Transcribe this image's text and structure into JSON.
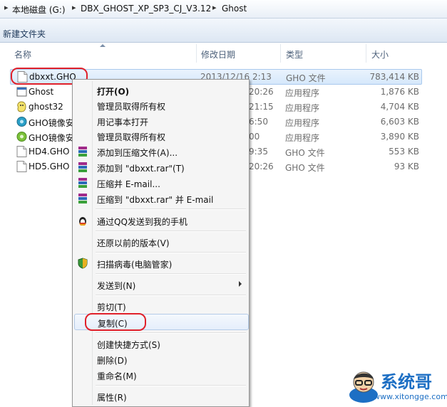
{
  "address": {
    "crumbs": [
      "本地磁盘 (G:)",
      "DBX_GHOST_XP_SP3_CJ_V3.12",
      "Ghost"
    ]
  },
  "toolbar": {
    "new_folder": "新建文件夹"
  },
  "columns": {
    "name": "名称",
    "date": "修改日期",
    "type": "类型",
    "size": "大小"
  },
  "files": [
    {
      "name": "dbxxt.GHO",
      "date": "2013/12/16 2:13",
      "type": "GHO 文件",
      "size": "783,414 KB",
      "icon": "document-icon"
    },
    {
      "name": "Ghost",
      "date": "20:26",
      "type": "应用程序",
      "size": "1,876 KB",
      "icon": "ghost-app-icon"
    },
    {
      "name": "ghost32",
      "date": "21:15",
      "type": "应用程序",
      "size": "4,704 KB",
      "icon": "ghost32-app-icon"
    },
    {
      "name": "GHO镜像安",
      "date": "6:50",
      "type": "应用程序",
      "size": "6,603 KB",
      "icon": "installer-icon"
    },
    {
      "name": "GHO镜像安",
      "date": "00",
      "type": "应用程序",
      "size": "3,890 KB",
      "icon": "installer-icon"
    },
    {
      "name": "HD4.GHO",
      "date": "9:35",
      "type": "GHO 文件",
      "size": "553 KB",
      "icon": "document-icon"
    },
    {
      "name": "HD5.GHO",
      "date": "20:26",
      "type": "GHO 文件",
      "size": "93 KB",
      "icon": "document-icon"
    }
  ],
  "menu": {
    "open": "打开(O)",
    "admin_owner_1": "管理员取得所有权",
    "open_notepad": "用记事本打开",
    "admin_owner_2": "管理员取得所有权",
    "add_archive": "添加到压缩文件(A)...",
    "add_rar": "添加到 \"dbxxt.rar\"(T)",
    "compress_email": "压缩并 E-mail...",
    "compress_rar_email": "压缩到 \"dbxxt.rar\" 并 E-mail",
    "qq_send": "通过QQ发送到我的手机",
    "restore": "还原以前的版本(V)",
    "scan": "扫描病毒(电脑管家)",
    "send_to": "发送到(N)",
    "cut": "剪切(T)",
    "copy": "复制(C)",
    "shortcut": "创建快捷方式(S)",
    "delete": "删除(D)",
    "rename": "重命名(M)",
    "properties": "属性(R)"
  },
  "watermark": {
    "brand": "系统哥",
    "url": "www.xitongge.com"
  },
  "colors": {
    "highlight_oval": "#e0202a",
    "selection": "#d6e8fb",
    "brand_blue": "#1d6fc4"
  }
}
